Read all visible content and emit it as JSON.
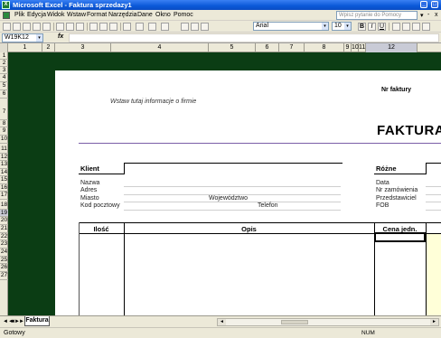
{
  "window": {
    "title": "Microsoft Excel - Faktura sprzedazy1",
    "app_icon": "X",
    "buttons": [
      "_",
      "□",
      "x"
    ]
  },
  "menu": {
    "items": [
      "Plik",
      "Edycja",
      "Widok",
      "Wstaw",
      "Format",
      "Narzędzia",
      "Dane",
      "Okno",
      "Pomoc"
    ],
    "help_placeholder": "Wpisz pytanie do Pomocy",
    "help_arrow": "▾",
    "doc_buttons": [
      "-",
      "x"
    ]
  },
  "toolbar": {
    "font": "Arial",
    "size": "10",
    "dropdown_arrow": "▾",
    "font_style_buttons": [
      "B",
      "I",
      "U"
    ]
  },
  "formula_bar": {
    "name_box": "W19K12",
    "fx": "fx",
    "value": ""
  },
  "columns": [
    "1",
    "2",
    "3",
    "4",
    "5",
    "6",
    "7",
    "8",
    "9",
    "10",
    "11",
    "12"
  ],
  "rows": [
    "1",
    "2",
    "3",
    "4",
    "5",
    "6",
    "7",
    "8",
    "9",
    "10",
    "11",
    "12",
    "13",
    "14",
    "15",
    "16",
    "17",
    "18",
    "19",
    "20",
    "21",
    "22",
    "23",
    "24",
    "25",
    "26",
    "27"
  ],
  "active_row": "19",
  "active_column": "12",
  "invoice": {
    "company_placeholder": "Wstaw tutaj informacje o firmie",
    "invoice_number_label": "Nr faktury",
    "title": "FAKTURA",
    "client_section": "Klient",
    "client_fields": {
      "name": "Nazwa",
      "address": "Adres",
      "city": "Miasto",
      "province": "Województwo",
      "postal": "Kod pocztowy",
      "phone": "Telefon"
    },
    "misc_section": "Różne",
    "misc_fields": [
      "Data",
      "Nr zamówienia",
      "Przedstawiciel",
      "FOB"
    ],
    "table_headers": {
      "qty": "Ilość",
      "desc": "Opis",
      "unit_price": "Cena jedn."
    }
  },
  "sheet_tabs": [
    "Faktura"
  ],
  "sheet_nav": [
    "◄◄",
    "◄",
    "►",
    "►►"
  ],
  "scroll_arrows": [
    "◄",
    "►"
  ],
  "status": {
    "ready": "Gotowy",
    "num": "NUM"
  },
  "colors": {
    "dark_green": "#0b3d14",
    "purple_rule": "#7b5ea7",
    "title_blue": "#0a58d8",
    "yellow_cell": "#ffffd8"
  }
}
